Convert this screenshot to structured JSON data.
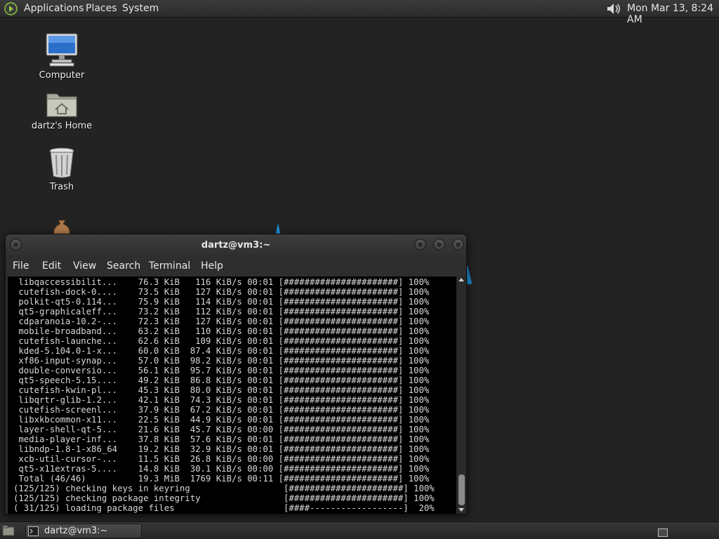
{
  "top_panel": {
    "menus": [
      "Applications",
      "Places",
      "System"
    ],
    "clock": "Mon Mar 13,  8:24 AM"
  },
  "desktop": {
    "icons": [
      {
        "label": "Computer",
        "icon": "computer-icon"
      },
      {
        "label": "dartz's Home",
        "icon": "home-folder-icon"
      },
      {
        "label": "Trash",
        "icon": "trash-icon"
      }
    ]
  },
  "window": {
    "title": "dartz@vm3:~",
    "menu": [
      "File",
      "Edit",
      "View",
      "Search",
      "Terminal",
      "Help"
    ],
    "lines": [
      " libqaccessibilit...    76.3 KiB   116 KiB/s 00:01 [######################] 100%",
      " cutefish-dock-0....    73.5 KiB   127 KiB/s 00:01 [######################] 100%",
      " polkit-qt5-0.114...    75.9 KiB   114 KiB/s 00:01 [######################] 100%",
      " qt5-graphicaleff...    73.2 KiB   112 KiB/s 00:01 [######################] 100%",
      " cdparanoia-10.2-...    72.3 KiB   127 KiB/s 00:01 [######################] 100%",
      " mobile-broadband...    63.2 KiB   110 KiB/s 00:01 [######################] 100%",
      " cutefish-launche...    62.6 KiB   109 KiB/s 00:01 [######################] 100%",
      " kded-5.104.0-1-x...    60.0 KiB  87.4 KiB/s 00:01 [######################] 100%",
      " xf86-input-synap...    57.0 KiB  98.2 KiB/s 00:01 [######################] 100%",
      " double-conversio...    56.1 KiB  95.7 KiB/s 00:01 [######################] 100%",
      " qt5-speech-5.15....    49.2 KiB  86.8 KiB/s 00:01 [######################] 100%",
      " cutefish-kwin-pl...    45.3 KiB  80.0 KiB/s 00:01 [######################] 100%",
      " libqrtr-glib-1.2...    42.1 KiB  74.3 KiB/s 00:01 [######################] 100%",
      " cutefish-screenl...    37.9 KiB  67.2 KiB/s 00:01 [######################] 100%",
      " libxkbcommon-x11...    22.5 KiB  44.9 KiB/s 00:01 [######################] 100%",
      " layer-shell-qt-5...    21.6 KiB  45.7 KiB/s 00:00 [######################] 100%",
      " media-player-inf...    37.8 KiB  57.6 KiB/s 00:01 [######################] 100%",
      " libndp-1.8-1-x86_64    19.2 KiB  32.9 KiB/s 00:01 [######################] 100%",
      " xcb-util-cursor-...    11.5 KiB  26.8 KiB/s 00:00 [######################] 100%",
      " qt5-x11extras-5....    14.8 KiB  30.1 KiB/s 00:00 [######################] 100%",
      " Total (46/46)          19.3 MiB  1769 KiB/s 00:11 [######################] 100%",
      "(125/125) checking keys in keyring                  [######################] 100%",
      "(125/125) checking package integrity                [######################] 100%",
      "( 31/125) loading package files                     [####------------------]  20%"
    ]
  },
  "taskbar": {
    "task_label": "dartz@vm3:~"
  }
}
